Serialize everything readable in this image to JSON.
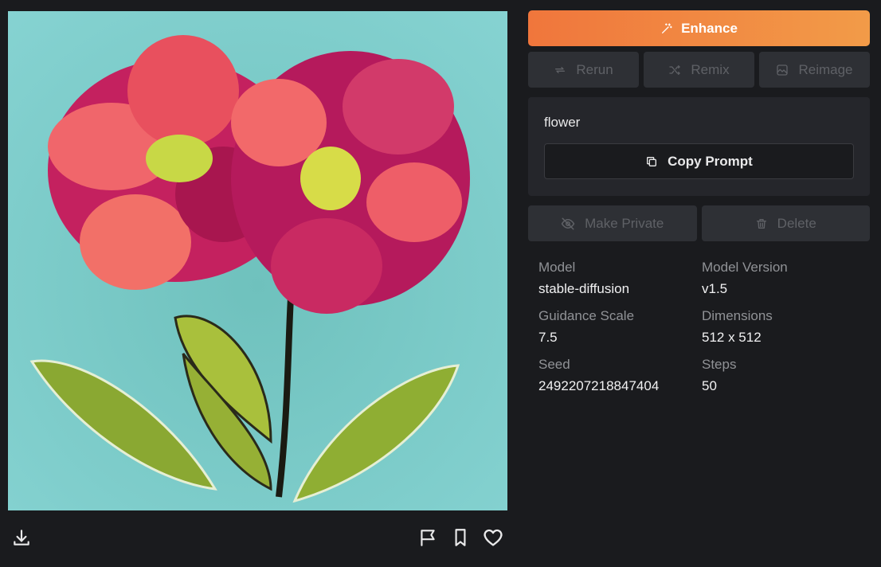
{
  "image": {
    "alt_subject": "flower painting"
  },
  "actions": {
    "enhance": "Enhance",
    "rerun": "Rerun",
    "remix": "Remix",
    "reimage": "Reimage",
    "make_private": "Make Private",
    "delete": "Delete",
    "copy_prompt": "Copy Prompt"
  },
  "prompt": "flower",
  "details": [
    {
      "label": "Model",
      "value": "stable-diffusion"
    },
    {
      "label": "Model Version",
      "value": "v1.5"
    },
    {
      "label": "Guidance Scale",
      "value": "7.5"
    },
    {
      "label": "Dimensions",
      "value": "512 x 512"
    },
    {
      "label": "Seed",
      "value": "2492207218847404"
    },
    {
      "label": "Steps",
      "value": "50"
    }
  ],
  "colors": {
    "accent_start": "#f0763c",
    "accent_end": "#f29b48",
    "background": "#1a1b1e"
  },
  "icons": [
    "download-icon",
    "flag-icon",
    "bookmark-icon",
    "heart-icon",
    "wand-icon",
    "rerun-icon",
    "remix-icon",
    "image-icon",
    "eye-off-icon",
    "trash-icon",
    "copy-icon"
  ]
}
